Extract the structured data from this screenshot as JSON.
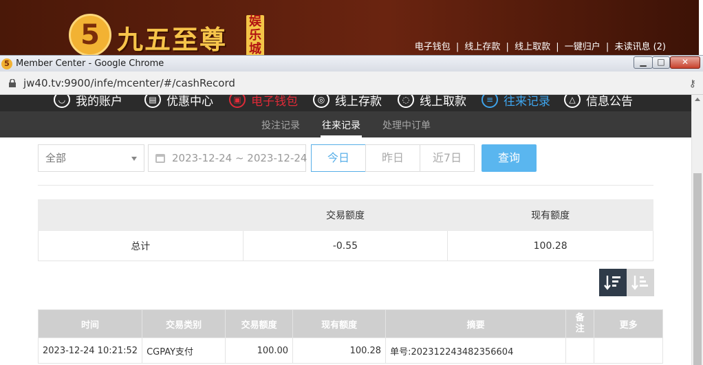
{
  "site": {
    "logo_numeral": "5",
    "logo_text": "九五至尊",
    "logo_badge": "娱乐城",
    "top_links": [
      "电子钱包",
      "线上存款",
      "线上取款",
      "一键归户",
      "未读讯息 (2)"
    ],
    "separator": "|"
  },
  "chrome": {
    "window_title": "Member Center - Google Chrome",
    "url": "jw40.tv:9900/infe/mcenter/#/cashRecord",
    "min_glyph": "▁",
    "max_glyph": "□",
    "close_glyph": "✕"
  },
  "main_nav": [
    {
      "label": "我的账户",
      "icon": "user-icon",
      "glyph": "◡"
    },
    {
      "label": "优惠中心",
      "icon": "gift-icon",
      "glyph": "▤"
    },
    {
      "label": "电子钱包",
      "icon": "wallet-icon",
      "glyph": "▣"
    },
    {
      "label": "线上存款",
      "icon": "deposit-icon",
      "glyph": "◎"
    },
    {
      "label": "线上取款",
      "icon": "withdraw-icon",
      "glyph": "◌"
    },
    {
      "label": "往来记录",
      "icon": "record-icon",
      "glyph": "≡"
    },
    {
      "label": "信息公告",
      "icon": "bell-icon",
      "glyph": "△"
    }
  ],
  "sub_nav": [
    "投注记录",
    "往来记录",
    "处理中订单"
  ],
  "filter": {
    "type_value": "全部",
    "date_range": "2023-12-24 ~ 2023-12-24",
    "today": "今日",
    "yesterday": "昨日",
    "last7": "近7日",
    "search": "查询"
  },
  "summary": {
    "headers": [
      "",
      "交易额度",
      "现有额度"
    ],
    "row": {
      "label": "总计",
      "amount": "-0.55",
      "balance": "100.28"
    }
  },
  "records": {
    "headers": [
      "时间",
      "交易类别",
      "交易额度",
      "现有额度",
      "摘要",
      "备注",
      "更多"
    ],
    "note_header_lines": [
      "备",
      "注"
    ],
    "rows": [
      {
        "time": "2023-12-24 10:21:52",
        "type": "CGPAY支付",
        "amount": "100.00",
        "balance": "100.28",
        "summary": "单号:202312243482356604",
        "note": "",
        "more": ""
      }
    ]
  },
  "colors": {
    "accent_blue": "#56aee8",
    "active_red": "#e02b38",
    "nav_dark": "#2b2b2b"
  }
}
